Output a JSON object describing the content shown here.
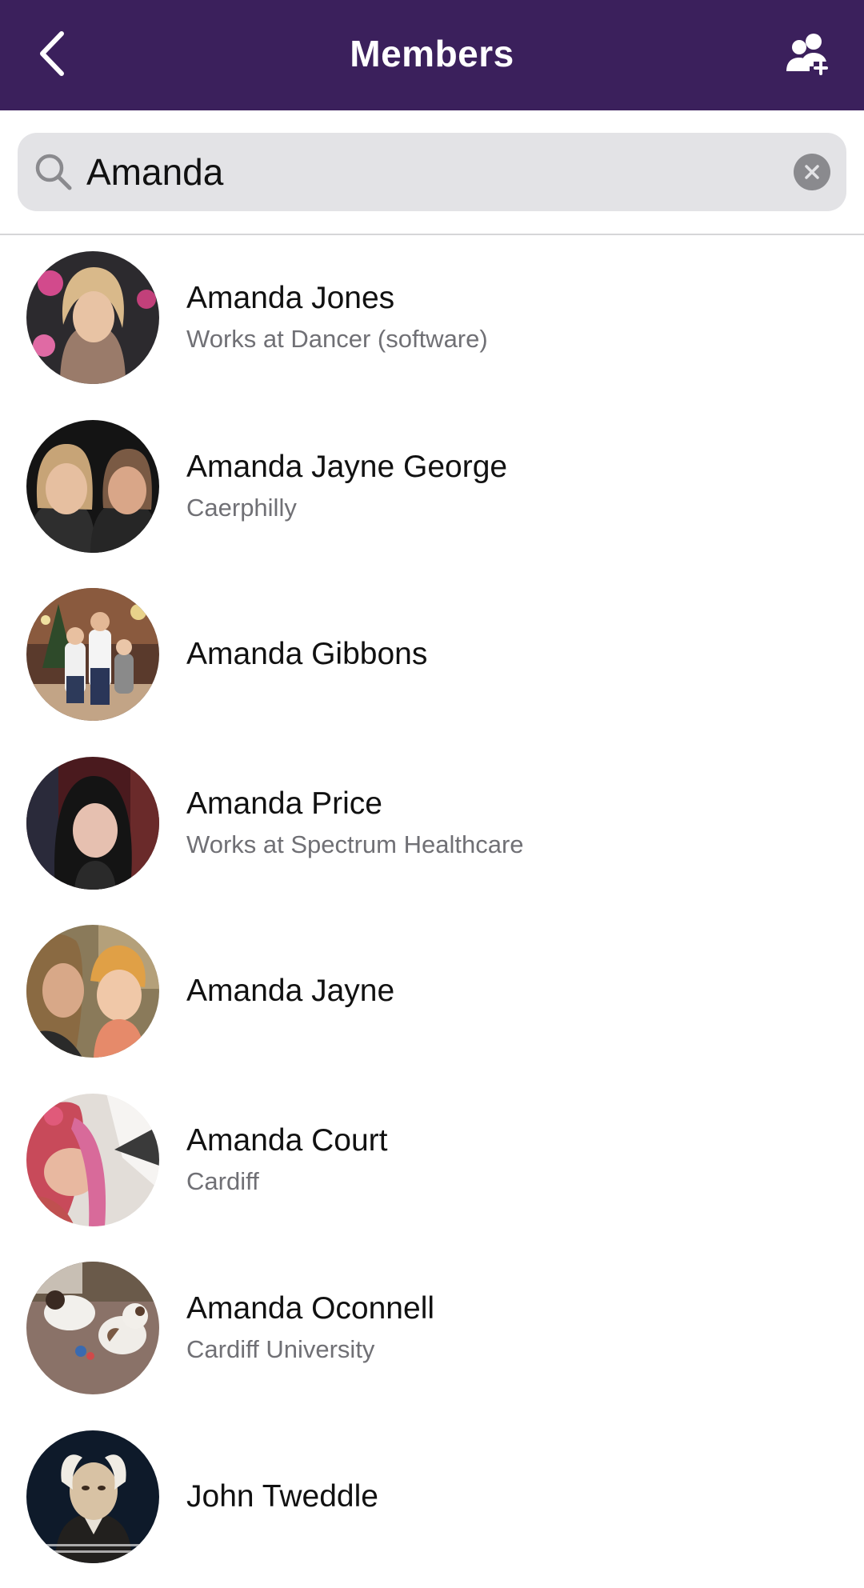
{
  "header": {
    "title": "Members",
    "back_icon": "chevron-left-icon",
    "add_member_icon": "add-user-icon",
    "background_color": "#3b205c"
  },
  "search": {
    "value": "Amanda",
    "placeholder": "Search",
    "icon": "search-icon",
    "clear_icon": "clear-icon"
  },
  "members": [
    {
      "name": "Amanda Jones",
      "subtitle": "Works at Dancer (software)"
    },
    {
      "name": "Amanda Jayne George",
      "subtitle": "Caerphilly"
    },
    {
      "name": "Amanda Gibbons",
      "subtitle": ""
    },
    {
      "name": "Amanda Price",
      "subtitle": "Works at Spectrum Healthcare"
    },
    {
      "name": "Amanda Jayne",
      "subtitle": ""
    },
    {
      "name": "Amanda Court",
      "subtitle": "Cardiff"
    },
    {
      "name": "Amanda Oconnell",
      "subtitle": "Cardiff University"
    },
    {
      "name": "John Tweddle",
      "subtitle": ""
    }
  ]
}
